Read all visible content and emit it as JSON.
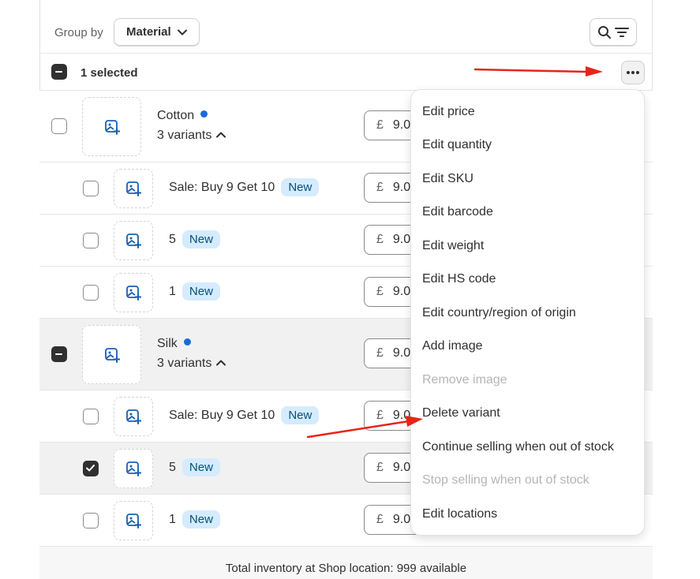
{
  "toolbar": {
    "group_label": "Group by",
    "group_value": "Material",
    "selected_text": "1 selected"
  },
  "products": [
    {
      "name": "Cotton",
      "variants_label": "3 variants",
      "price_currency": "£",
      "price_value": "9.00",
      "variants": [
        {
          "name": "Sale: Buy 9 Get 10",
          "badge": "New",
          "price_currency": "£",
          "price_value": "9.00"
        },
        {
          "name": "5",
          "badge": "New",
          "price_currency": "£",
          "price_value": "9.00"
        },
        {
          "name": "1",
          "badge": "New",
          "price_currency": "£",
          "price_value": "9.00"
        }
      ]
    },
    {
      "name": "Silk",
      "variants_label": "3 variants",
      "price_currency": "£",
      "price_value": "9.00",
      "variants": [
        {
          "name": "Sale: Buy 9 Get 10",
          "badge": "New",
          "price_currency": "£",
          "price_value": "9.00"
        },
        {
          "name": "5",
          "badge": "New",
          "price_currency": "£",
          "price_value": "9.00",
          "selected": true
        },
        {
          "name": "1",
          "badge": "New",
          "price_currency": "£",
          "price_value": "9.00"
        }
      ]
    }
  ],
  "menu": {
    "items": [
      {
        "label": "Edit price",
        "disabled": false
      },
      {
        "label": "Edit quantity",
        "disabled": false
      },
      {
        "label": "Edit SKU",
        "disabled": false
      },
      {
        "label": "Edit barcode",
        "disabled": false
      },
      {
        "label": "Edit weight",
        "disabled": false
      },
      {
        "label": "Edit HS code",
        "disabled": false
      },
      {
        "label": "Edit country/region of origin",
        "disabled": false
      },
      {
        "label": "Add image",
        "disabled": false
      },
      {
        "label": "Remove image",
        "disabled": true
      },
      {
        "label": "Delete variant",
        "disabled": false
      },
      {
        "label": "Continue selling when out of stock",
        "disabled": false
      },
      {
        "label": "Stop selling when out of stock",
        "disabled": true
      },
      {
        "label": "Edit locations",
        "disabled": false
      }
    ]
  },
  "footer": {
    "text": "Total inventory at Shop location: 999 available"
  },
  "colors": {
    "accent_dot": "#1b6ad6",
    "badge_bg": "#d5ebff",
    "badge_text": "#00527c",
    "annotation_arrow": "#e8241a"
  }
}
